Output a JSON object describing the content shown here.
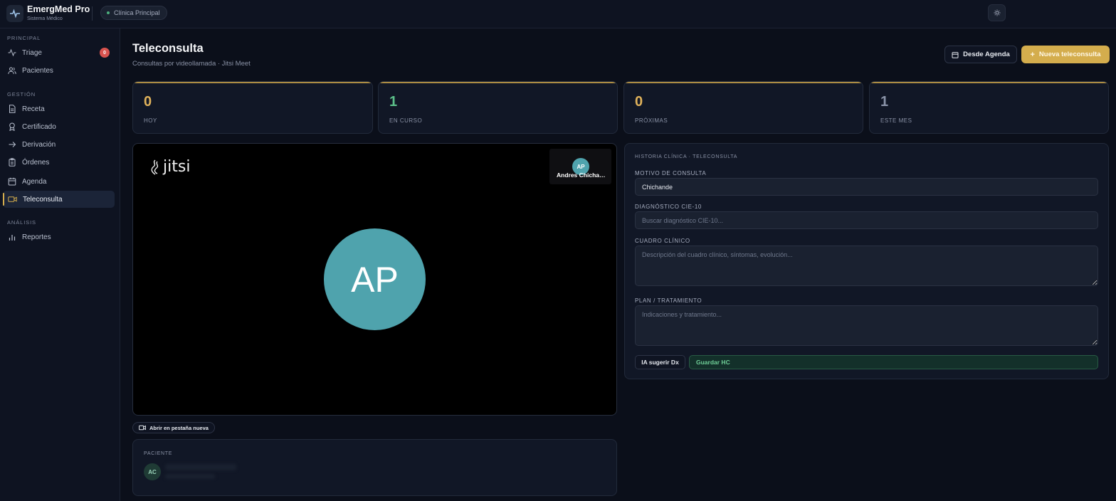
{
  "brand": {
    "title": "EmergMed Pro",
    "subtitle": "Sistema Médico",
    "clinic": "Clínica Principal"
  },
  "sidebar": {
    "sections": [
      {
        "label": "PRINCIPAL"
      },
      {
        "label": "GESTIÓN"
      },
      {
        "label": "ANÁLISIS"
      }
    ],
    "items": [
      {
        "label": "Triage",
        "badge": "0"
      },
      {
        "label": "Pacientes"
      },
      {
        "label": "Receta"
      },
      {
        "label": "Certificado"
      },
      {
        "label": "Derivación"
      },
      {
        "label": "Órdenes"
      },
      {
        "label": "Agenda"
      },
      {
        "label": "Teleconsulta",
        "active": true
      },
      {
        "label": "Reportes"
      }
    ]
  },
  "header": {
    "title": "Teleconsulta",
    "subtitle": "Consultas por videollamada · Jitsi Meet",
    "agenda_button": "Desde Agenda",
    "new_button": "Nueva teleconsulta"
  },
  "stats": [
    {
      "value": "0",
      "label": "HOY",
      "color": "#e0b25b"
    },
    {
      "value": "1",
      "label": "EN CURSO",
      "color": "#5cc08a"
    },
    {
      "value": "0",
      "label": "PRÓXIMAS",
      "color": "#e0b25b"
    },
    {
      "value": "1",
      "label": "ESTE MES",
      "color": "#8a93a8"
    }
  ],
  "video": {
    "logo_text": "jitsi",
    "main_initials": "AP",
    "thumb_initials": "AP",
    "thumb_name": "Andres Chichande",
    "open_tab_button": "Abrir en pestaña nueva"
  },
  "patient": {
    "label": "PACIENTE",
    "initials": "AC"
  },
  "clinical_history": {
    "title": "HISTORIA CLÍNICA · TELECONSULTA",
    "motivo": {
      "label": "MOTIVO DE CONSULTA",
      "value": "Chichande"
    },
    "diagnostico": {
      "label": "DIAGNÓSTICO CIE-10",
      "placeholder": "Buscar diagnóstico CIE-10..."
    },
    "cuadro": {
      "label": "CUADRO CLÍNICO",
      "placeholder": "Descripción del cuadro clínico, síntomas, evolución..."
    },
    "plan": {
      "label": "PLAN / TRATAMIENTO",
      "placeholder": "Indicaciones y tratamiento..."
    },
    "ia_button": "IA sugerir Dx",
    "save_button": "Guardar HC"
  },
  "colors": {
    "accent": "#d4ad4d",
    "success": "#6fcf97",
    "avatar": "#4fa3ad"
  }
}
